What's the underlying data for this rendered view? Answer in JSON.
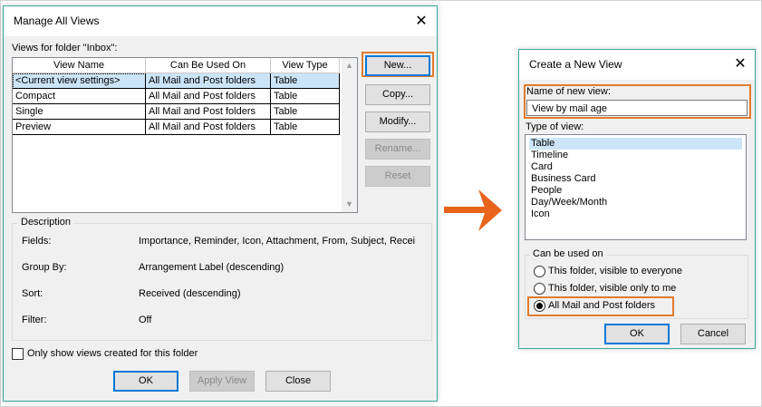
{
  "manage_views": {
    "title": "Manage All Views",
    "close_glyph": "✕",
    "views_label": "Views for folder \"Inbox\":",
    "columns": [
      "View Name",
      "Can Be Used On",
      "View Type"
    ],
    "rows": [
      {
        "name": "<Current view settings>",
        "used_on": "All Mail and Post folders",
        "type": "Table"
      },
      {
        "name": "Compact",
        "used_on": "All Mail and Post folders",
        "type": "Table"
      },
      {
        "name": "Single",
        "used_on": "All Mail and Post folders",
        "type": "Table"
      },
      {
        "name": "Preview",
        "used_on": "All Mail and Post folders",
        "type": "Table"
      }
    ],
    "buttons": {
      "new": "New...",
      "copy": "Copy...",
      "modify": "Modify...",
      "rename": "Rename...",
      "reset": "Reset"
    },
    "description": {
      "legend": "Description",
      "fields_label": "Fields:",
      "fields_value": "Importance, Reminder, Icon, Attachment, From, Subject, Recei",
      "group_by_label": "Group By:",
      "group_by_value": "Arrangement Label (descending)",
      "sort_label": "Sort:",
      "sort_value": "Received (descending)",
      "filter_label": "Filter:",
      "filter_value": "Off"
    },
    "only_show_label": "Only show views created for this folder",
    "ok": "OK",
    "apply_view": "Apply View",
    "close": "Close"
  },
  "create_view": {
    "title": "Create a New View",
    "close_glyph": "✕",
    "name_label": "Name of new view:",
    "name_value": "View by mail age",
    "type_label": "Type of view:",
    "types": [
      "Table",
      "Timeline",
      "Card",
      "Business Card",
      "People",
      "Day/Week/Month",
      "Icon"
    ],
    "selected_type": "Table",
    "can_be_used_legend": "Can be used on",
    "options": [
      {
        "label": "This folder, visible to everyone",
        "checked": false
      },
      {
        "label": "This folder, visible only to me",
        "checked": false
      },
      {
        "label": "All Mail and Post folders",
        "checked": true
      }
    ],
    "ok": "OK",
    "cancel": "Cancel"
  },
  "colors": {
    "highlight": "#e07b2e",
    "selection": "#cce4f7",
    "dialog_border": "#3aa79a",
    "arrow": "#e8641b"
  }
}
